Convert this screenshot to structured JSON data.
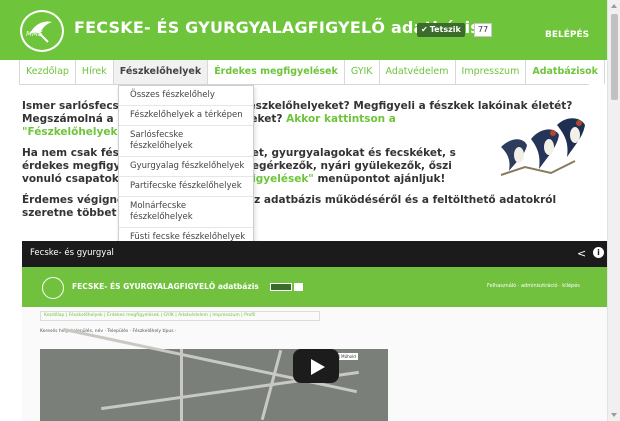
{
  "header": {
    "logo_text": "MME",
    "title": "FECSKE- ÉS GYURGYALAGFIGYELŐ adatbázis",
    "like_label": "Tetszik",
    "like_count": "77",
    "login_label": "BELÉPÉS",
    "bg_color": "#6ec43a"
  },
  "nav": {
    "items": [
      {
        "label": "Kezdőlap"
      },
      {
        "label": "Hírek"
      },
      {
        "label": "Fészkelőhelyek"
      },
      {
        "label": "Érdekes megfigyelések"
      },
      {
        "label": "GYIK"
      },
      {
        "label": "Adatvédelem"
      },
      {
        "label": "Impresszum"
      },
      {
        "label": "Adatbázisok"
      }
    ]
  },
  "dropdown": {
    "items": [
      "Összes fészkelőhely",
      "Fészkelőhelyek a térképen",
      "Sarlósfecske fészkelőhelyek",
      "Gyurgyalag fészkelőhelyek",
      "Partifecske fészkelőhelyek",
      "Molnárfecske fészkelőhelyek",
      "Füsti fecske fészkelőhelyek"
    ]
  },
  "content": {
    "p1_a": "Ismer sarlósfecsk",
    "p1_b": "ke-fészkelőhelyeket? Megfigyeli a fészkek lakóinak életét?",
    "p1_c": "Megszámolná a k",
    "p1_d": "észkeket?",
    "p1_link": "Akkor kattintson a",
    "p1_link2": "\"Fészkelőhelyek\"",
    "p2_a": "Ha nem csak fész",
    "p2_b": "skéket, gyurgyalagokat és fecskéket, s",
    "p2_c": "érdekes megfigye",
    "p2_d": "zi megérkezők, nyári gyülekezők, őszi",
    "p2_e": "vonuló csapatok",
    "p2_link": "negfigyelések\"",
    "p2_f": "menüpontot ajánljuk!",
    "p3_a": "Érdemes végigné",
    "p3_b": "z adatbázis működéséről és a feltölthető adatokról",
    "p3_c": "szeretne többet n"
  },
  "video": {
    "title": "Fecske- és gyurgyal",
    "inner_title": "FECSKE- ÉS GYURGYALAGFIGYELŐ adatbázis",
    "inner_right": "Felhasználó · adminisztráció · kilépés",
    "inner_nav": "Kezdőlap | Fészkelőhelyek | Érdekes megfigyelések | GYIK | Adatvédelem | Impresszum | Profil",
    "inner_form": "Keresés hely, település, név · Település · Fészkelőhely típus ·",
    "map_button": "Térkép | Műhold"
  },
  "colors": {
    "accent": "#6ec43a",
    "dark_accent": "#3c6c2c"
  }
}
